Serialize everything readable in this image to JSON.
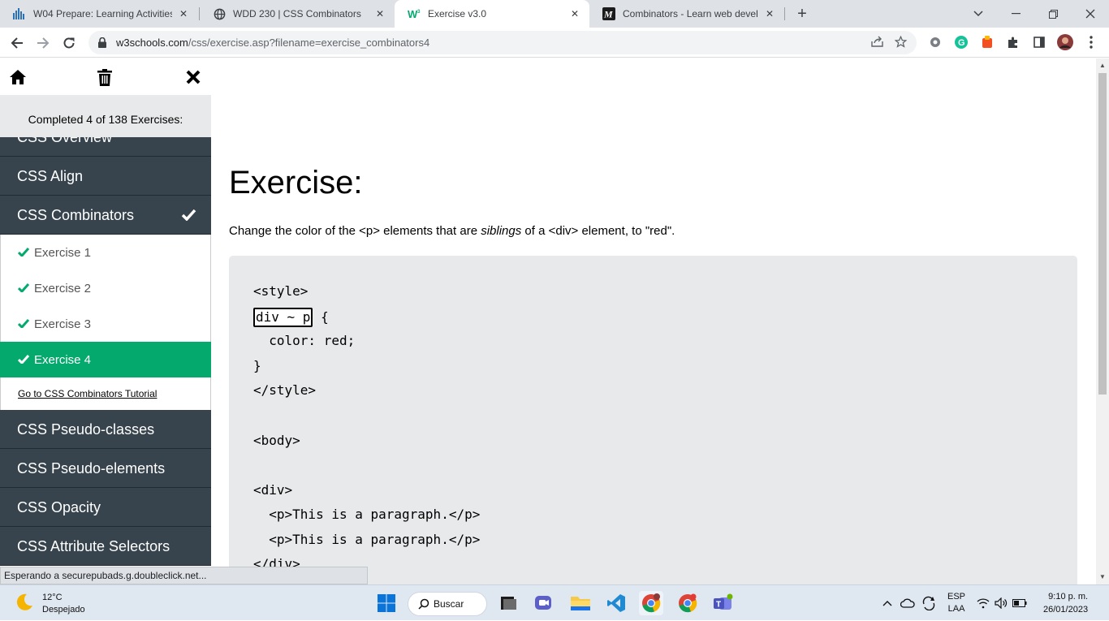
{
  "browser": {
    "tabs": [
      {
        "title": "W04 Prepare: Learning Activities",
        "icon": "canvas-bars-icon",
        "active": false
      },
      {
        "title": "WDD 230 | CSS Combinators",
        "icon": "globe-icon",
        "active": false
      },
      {
        "title": "Exercise v3.0",
        "icon": "w3schools-icon",
        "active": true
      },
      {
        "title": "Combinators - Learn web develo",
        "icon": "mdn-icon",
        "active": false
      }
    ],
    "url_host": "w3schools.com",
    "url_path": "/css/exercise.asp?filename=exercise_combinators4",
    "status_text": "Esperando a securepubads.g.doubleclick.net..."
  },
  "sidebar": {
    "progress_text": "Completed 4 of 138 Exercises:",
    "partial_category": "CSS Overview",
    "categories_before": [
      "CSS Align"
    ],
    "current_category": "CSS Combinators",
    "exercises": [
      {
        "label": "Exercise 1",
        "done": true,
        "active": false
      },
      {
        "label": "Exercise 2",
        "done": true,
        "active": false
      },
      {
        "label": "Exercise 3",
        "done": true,
        "active": false
      },
      {
        "label": "Exercise 4",
        "done": true,
        "active": true
      }
    ],
    "tutorial_link": "Go to CSS Combinators Tutorial",
    "categories_after": [
      "CSS Pseudo-classes",
      "CSS Pseudo-elements",
      "CSS Opacity",
      "CSS Attribute Selectors"
    ]
  },
  "exercise": {
    "heading": "Exercise:",
    "instr_1": "Change the color of the <p> elements that are ",
    "instr_em": "siblings",
    "instr_2": " of a <div> element, to \"red\".",
    "code": {
      "line_style_open": "<style>",
      "answer_value": "div ~ p",
      "line_brace_open": " {",
      "line_color": "  color: red;",
      "line_brace_close": "}",
      "line_style_close": "</style>",
      "line_body": "<body>",
      "line_div_open": "<div>",
      "line_p1": "  <p>This is a paragraph.</p>",
      "line_p2": "  <p>This is a paragraph.</p>",
      "line_div_close": "</div>"
    }
  },
  "taskbar": {
    "temperature": "12°C",
    "weather": "Despejado",
    "search_label": "Buscar",
    "language": "ESP",
    "layout": "LAA",
    "time": "9:10 p. m.",
    "date": "26/01/2023"
  },
  "colors": {
    "accent_green": "#04aa6d",
    "sidebar_dark": "#38444d"
  }
}
